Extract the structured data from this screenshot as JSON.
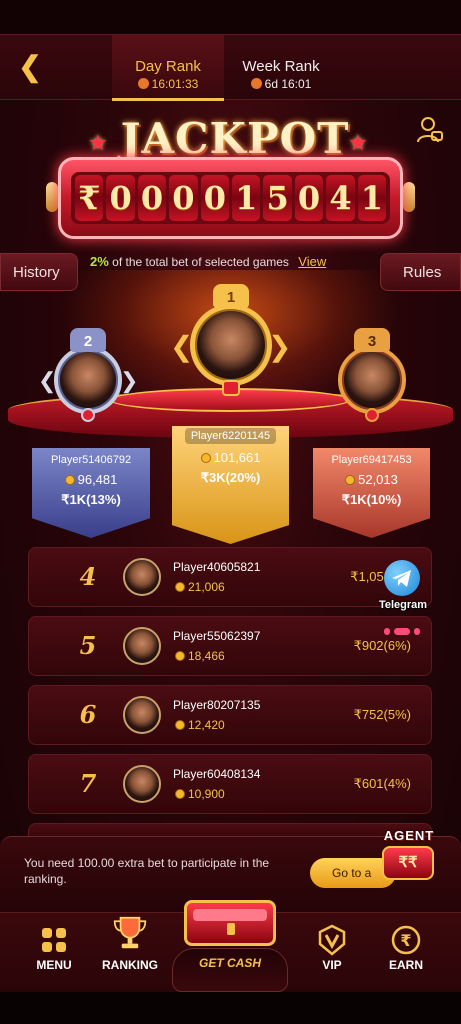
{
  "header": {
    "tabs": [
      {
        "label": "Day Rank",
        "time": "16:01:33"
      },
      {
        "label": "Week Rank",
        "time": "6d 16:01"
      }
    ]
  },
  "jackpot": {
    "title": "JACKPOT",
    "currency": "₹",
    "digits": [
      "0",
      "0",
      "0",
      "0",
      "1",
      "5",
      "0",
      "4",
      "1"
    ],
    "percent": "2%",
    "description": "of the total bet of selected games",
    "view_label": "View"
  },
  "side_buttons": {
    "history": "History",
    "rules": "Rules"
  },
  "top3": [
    {
      "rank": "2",
      "name": "Player51406792",
      "coins": "96,481",
      "reward": "₹1K(13%)"
    },
    {
      "rank": "1",
      "name": "Player62201145",
      "coins": "101,661",
      "reward": "₹3K(20%)"
    },
    {
      "rank": "3",
      "name": "Player69417453",
      "coins": "52,013",
      "reward": "₹1K(10%)"
    }
  ],
  "list": [
    {
      "rank": "4",
      "name": "Player40605821",
      "coins": "21,006",
      "reward": "₹1,052"
    },
    {
      "rank": "5",
      "name": "Player55062397",
      "coins": "18,466",
      "reward": "₹902(6%)"
    },
    {
      "rank": "6",
      "name": "Player80207135",
      "coins": "12,420",
      "reward": "₹752(5%)"
    },
    {
      "rank": "7",
      "name": "Player60408134",
      "coins": "10,900",
      "reward": "₹601(4%)"
    }
  ],
  "telegram": {
    "label": "Telegram"
  },
  "notice": {
    "text": "You need 100.00 extra bet to participate in the ranking.",
    "goto_label": "Go to a",
    "agent_label": "AGENT",
    "agent_box": "₹₹"
  },
  "nav": {
    "items": [
      {
        "label": "MENU"
      },
      {
        "label": "RANKING"
      },
      {
        "label": "GET CASH"
      },
      {
        "label": "VIP"
      },
      {
        "label": "EARN"
      }
    ]
  },
  "colors": {
    "accent": "#f5c14b",
    "background": "#2a0509",
    "jackpot_red": "#c31a2a"
  }
}
